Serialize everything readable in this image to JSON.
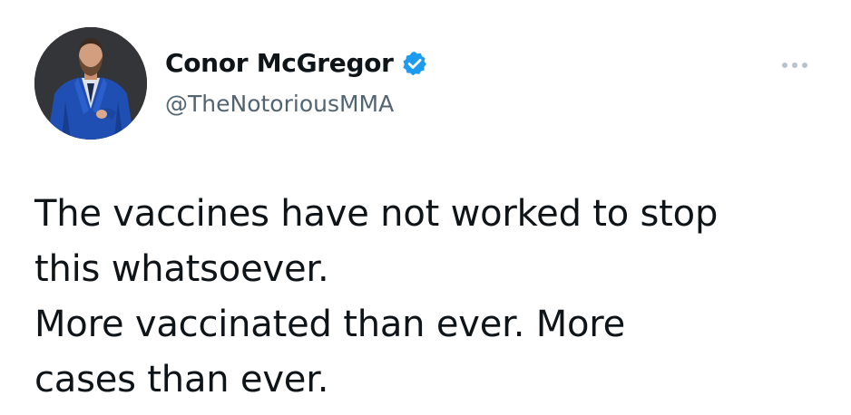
{
  "tweet": {
    "author": {
      "display_name": "Conor McGregor",
      "handle": "@TheNotoriousMMA",
      "verified": true
    },
    "text_lines": [
      "The vaccines have not worked to stop",
      "this whatsoever.",
      "More vaccinated than ever. More",
      "cases than ever."
    ]
  },
  "icons": {
    "verified": "verified-badge-icon",
    "more": "more-options-icon"
  },
  "colors": {
    "verified_blue": "#1d9bf0",
    "text": "#0f1419",
    "secondary_text": "#536471",
    "more_dots": "#b9c2ca"
  }
}
